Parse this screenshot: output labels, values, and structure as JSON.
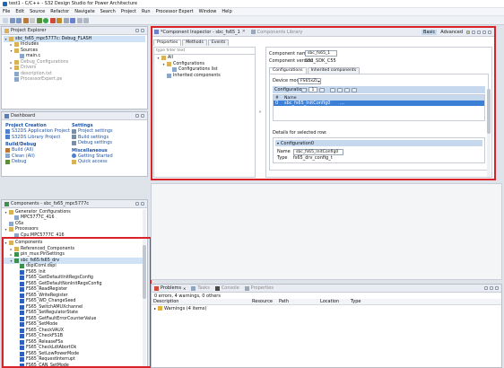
{
  "window": {
    "title": "test1 - C/C++ - S32 Design Studio for Power Architecture"
  },
  "menu": [
    "File",
    "Edit",
    "Source",
    "Refactor",
    "Navigate",
    "Search",
    "Project",
    "Run",
    "Processor Expert",
    "Window",
    "Help"
  ],
  "project_explorer": {
    "tab": "Project Explorer",
    "items": [
      {
        "label": "sbc_fs65_mpc5777c: Debug_FLASH",
        "level": 0,
        "twisty": "▾",
        "selected": true
      },
      {
        "label": "Includes",
        "level": 1,
        "twisty": "▸",
        "dim": false
      },
      {
        "label": "Sources",
        "level": 1,
        "twisty": "▾",
        "dim": false
      },
      {
        "label": "main.c",
        "level": 2,
        "twisty": "",
        "dim": false
      },
      {
        "label": "Debug_Configurations",
        "level": 1,
        "twisty": "▸",
        "dim": true
      },
      {
        "label": "Drivers",
        "level": 1,
        "twisty": "▸",
        "dim": true
      },
      {
        "label": "description.txt",
        "level": 1,
        "twisty": "",
        "dim": true
      },
      {
        "label": "ProcessorExpert.pe",
        "level": 1,
        "twisty": "",
        "dim": true
      }
    ]
  },
  "dashboard": {
    "tab": "Dashboard",
    "project_creation": {
      "heading": "Project Creation",
      "links": [
        "S32DS Application Project",
        "S32DS Library Project"
      ]
    },
    "build_debug": {
      "heading": "Build/Debug",
      "links": [
        "Build (All)",
        "Clean (All)",
        "Debug"
      ]
    },
    "settings": {
      "heading": "Settings",
      "links": [
        "Project settings",
        "Build settings",
        "Debug settings"
      ]
    },
    "misc": {
      "heading": "Miscellaneous",
      "links": [
        "Getting Started",
        "Quick access"
      ]
    }
  },
  "components_view": {
    "tab": "Components - sbc_fs65_mpc5777c",
    "top_items": [
      {
        "label": "Generator_Configurations",
        "level": 0,
        "twisty": "▾"
      },
      {
        "label": "MPC5777C_416",
        "level": 1,
        "twisty": ""
      },
      {
        "label": "OSs",
        "level": 0,
        "twisty": ""
      },
      {
        "label": "Processors",
        "level": 0,
        "twisty": "▾"
      },
      {
        "label": "Cpu:MPC5777C_416",
        "level": 1,
        "twisty": ""
      }
    ],
    "components_label": "Components",
    "component_children": [
      {
        "label": "Referenced_Components",
        "level": 1,
        "twisty": "▸",
        "kind": "folder"
      },
      {
        "label": "pin_mux:PinSettings",
        "level": 1,
        "twisty": "▸",
        "kind": "comp"
      },
      {
        "label": "sbc_fs65:fs65_drv",
        "level": 1,
        "twisty": "▾",
        "kind": "comp",
        "selected": true
      },
      {
        "label": "dspiComl.dspi",
        "level": 2,
        "twisty": "",
        "kind": "comp"
      }
    ],
    "methods": [
      "FS65_Init",
      "FS65_GetDefaultInitRegsConfig",
      "FS65_GetDefaultNonInitRegsConfig",
      "FS65_ReadRegister",
      "FS65_WriteRegister",
      "FS65_WD_ChangeSeed",
      "FS65_SwitchAMUXchannel",
      "FS65_SetRegulatorState",
      "FS65_GetFaultErrorCounterValue",
      "FS65_SetMode",
      "FS65_CheckVAUX",
      "FS65_CheckFS1B",
      "FS65_ReleaseFSx",
      "FS65_CheckLdtAbortOk",
      "FS65_SetLowPowerMode",
      "FS65_RequestInterrupt",
      "FS65_CAN_SetMode"
    ]
  },
  "inspector": {
    "tab": "*Component Inspector - sbc_fs65_1",
    "tab2": "Components Library",
    "mode_basic": "Basic",
    "mode_advanced": "Advanced",
    "subtabs": [
      "Properties",
      "Methods",
      "Events"
    ],
    "filter_placeholder": "type filter text",
    "tree": [
      {
        "label": "All",
        "level": 0,
        "twisty": "▾"
      },
      {
        "label": "Configurations",
        "level": 1,
        "twisty": "▾"
      },
      {
        "label": "Configurations list",
        "level": 2,
        "twisty": ""
      },
      {
        "label": "Inherited components",
        "level": 1,
        "twisty": ""
      }
    ],
    "component_name_label": "Component name",
    "component_name": "sbc_fs65_1",
    "component_version_label": "Component version",
    "component_version": "S32_SDK_C55",
    "inner_tabs": [
      "Configurations",
      "Inherited components"
    ],
    "device_model_label": "Device model",
    "device_model": "FS65xZL",
    "config_list_label": "Configurations list",
    "config_count": "1",
    "grid_headers": [
      "#",
      "Name"
    ],
    "grid_rows": [
      {
        "num": "0",
        "name": "sbc_fs65_InitConfig0"
      }
    ],
    "details_label": "Details for selected row:",
    "details_group": "Configuration0",
    "detail_fields": [
      {
        "label": "Name",
        "value": "sbc_fs65_InitConfig0"
      },
      {
        "label": "Type",
        "value": "fs65_drv_config_t"
      }
    ]
  },
  "problems": {
    "tabs": [
      "Problems",
      "Tasks",
      "Console",
      "Properties"
    ],
    "summary": "0 errors, 4 warnings, 0 others",
    "headers": [
      "Description",
      "Resource",
      "Path",
      "Location",
      "Type"
    ],
    "rows": [
      {
        "description": "Warnings (4 items)"
      }
    ]
  }
}
